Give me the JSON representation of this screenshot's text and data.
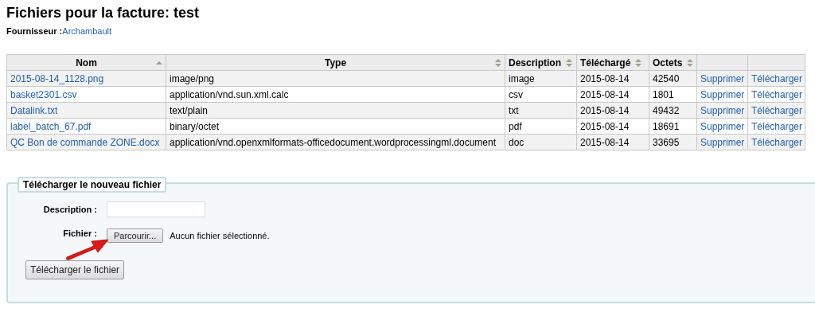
{
  "title": "Fichiers pour la facture: test",
  "supplier": {
    "label": "Fournisseur :",
    "link": "Archambault"
  },
  "table": {
    "columns": [
      {
        "label": "Nom",
        "sortable": true,
        "sorted": true
      },
      {
        "label": "Type",
        "sortable": true,
        "sorted": false
      },
      {
        "label": "Description",
        "sortable": true,
        "sorted": false
      },
      {
        "label": "Téléchargé",
        "sortable": true,
        "sorted": false
      },
      {
        "label": "Octets",
        "sortable": true,
        "sorted": false
      }
    ],
    "rows": [
      {
        "name": "2015-08-14_1128.png",
        "type": "image/png",
        "description": "image",
        "date": "2015-08-14",
        "size": "42540",
        "delete": "Supprimer",
        "download": "Télécharger"
      },
      {
        "name": "basket2301.csv",
        "type": "application/vnd.sun.xml.calc",
        "description": "csv",
        "date": "2015-08-14",
        "size": "1801",
        "delete": "Supprimer",
        "download": "Télécharger"
      },
      {
        "name": "Datalink.txt",
        "type": "text/plain",
        "description": "txt",
        "date": "2015-08-14",
        "size": "49432",
        "delete": "Supprimer",
        "download": "Télécharger"
      },
      {
        "name": "label_batch_67.pdf",
        "type": "binary/octet",
        "description": "pdf",
        "date": "2015-08-14",
        "size": "18691",
        "delete": "Supprimer",
        "download": "Télécharger"
      },
      {
        "name": "QC Bon de commande ZONE.docx",
        "type": "application/vnd.openxmlformats-officedocument.wordprocessingml.document",
        "description": "doc",
        "date": "2015-08-14",
        "size": "33695",
        "delete": "Supprimer",
        "download": "Télécharger"
      }
    ]
  },
  "upload": {
    "legend": "Télécharger le nouveau fichier",
    "description_label": "Description :",
    "file_label": "Fichier :",
    "browse_button": "Parcourir...",
    "file_status": "Aucun fichier sélectionné.",
    "submit_button": "Télécharger le fichier"
  }
}
